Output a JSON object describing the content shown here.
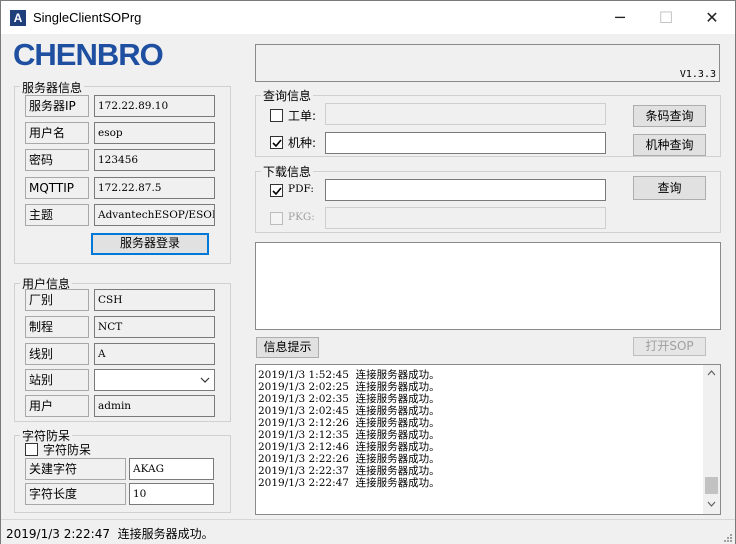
{
  "window": {
    "title": "SingleClientSOPrg",
    "app_icon_letter": "A",
    "minimize": "─",
    "maximize": "☐",
    "close": "✕"
  },
  "logo": {
    "text": "CHENBRO"
  },
  "server": {
    "group_title": "服务器信息",
    "fields": [
      {
        "label": "服务器IP",
        "value": "172.22.89.10"
      },
      {
        "label": "用户名",
        "value": "esop"
      },
      {
        "label": "密码",
        "value": "123456"
      },
      {
        "label": "MQTTIP",
        "value": "172.22.87.5"
      },
      {
        "label": "主题",
        "value": "AdvantechESOP/ESOP_Clien"
      }
    ],
    "login_button": "服务器登录"
  },
  "user": {
    "group_title": "用户信息",
    "fields": [
      {
        "label": "厂别",
        "value": "CSH"
      },
      {
        "label": "制程",
        "value": "NCT"
      },
      {
        "label": "线别",
        "value": "A"
      },
      {
        "label": "站别",
        "value": ""
      },
      {
        "label": "用户",
        "value": "admin"
      }
    ]
  },
  "antidup": {
    "group_title": "字符防呆",
    "checkbox_label": "字符防呆",
    "keyword_label": "关建字符",
    "keyword_value": "AKAG",
    "length_label": "字符长度",
    "length_value": "10"
  },
  "version": "V1.3.3",
  "query": {
    "group_title": "查询信息",
    "workorder_label": "工单:",
    "workorder_value": "",
    "model_label": "机种:",
    "model_value": "",
    "barcode_button": "条码查询",
    "model_button": "机种查询"
  },
  "download": {
    "group_title": "下载信息",
    "pdf_label": "PDF:",
    "pdf_value": "",
    "pkg_label": "PKG:",
    "pkg_value": "",
    "query_button": "查询"
  },
  "info_button": "信息提示",
  "open_sop_button": "打开SOP",
  "log": [
    "2019/1/3 1:52:45  连接服务器成功。",
    "2019/1/3 2:02:25  连接服务器成功。",
    "2019/1/3 2:02:35  连接服务器成功。",
    "2019/1/3 2:02:45  连接服务器成功。",
    "2019/1/3 2:12:26  连接服务器成功。",
    "2019/1/3 2:12:35  连接服务器成功。",
    "2019/1/3 2:12:46  连接服务器成功。",
    "2019/1/3 2:22:26  连接服务器成功。",
    "2019/1/3 2:22:37  连接服务器成功。",
    "2019/1/3 2:22:47  连接服务器成功。"
  ],
  "status": "2019/1/3 2:22:47  连接服务器成功。",
  "colors": {
    "logo_blue": "#1e4fa0",
    "focus_blue": "#0078d7"
  }
}
